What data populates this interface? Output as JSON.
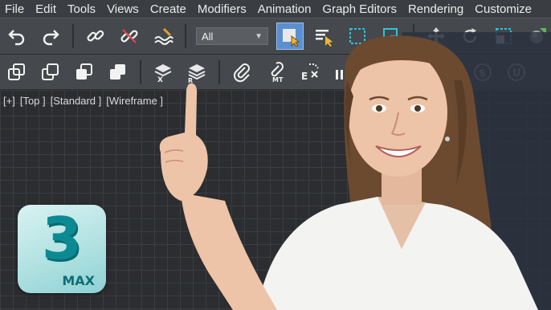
{
  "menubar": {
    "items": [
      "File",
      "Edit",
      "Tools",
      "Views",
      "Create",
      "Modifiers",
      "Animation",
      "Graph Editors",
      "Rendering",
      "Customize"
    ]
  },
  "toolbar_main": {
    "selection_filter": "All",
    "icons": [
      "undo-icon",
      "redo-icon",
      "link-icon",
      "unlink-icon",
      "bind-space-warp-icon",
      "select-object-icon",
      "select-by-name-icon",
      "region-select-icon",
      "window-crossing-icon",
      "move-icon",
      "rotate-icon",
      "scale-icon",
      "material-icon"
    ]
  },
  "toolbar_secondary": {
    "icons": [
      "clone-icon",
      "copy-icon",
      "instance-icon",
      "reference-icon",
      "layer-x-icon",
      "layer-r-icon",
      "attach-icon",
      "mt-icon",
      "ex-icon",
      "ik-icon",
      "dollar-icon",
      "u-icon"
    ],
    "labels": {
      "layer_x": "X",
      "layer_r": "R",
      "mt": "MT",
      "ex": "E"
    }
  },
  "viewport": {
    "label_parts": [
      "[+]",
      "[Top ]",
      "[Standard ]",
      "[Wireframe ]"
    ]
  },
  "logo": {
    "numeral": "3",
    "text": "MAX"
  },
  "colors": {
    "menubar_bg": "#3a3d41",
    "toolbar_bg": "#45484c",
    "active_button": "#5b8fd0",
    "viewport_bg": "#2b2d30",
    "logo_teal": "#0c8a93"
  }
}
